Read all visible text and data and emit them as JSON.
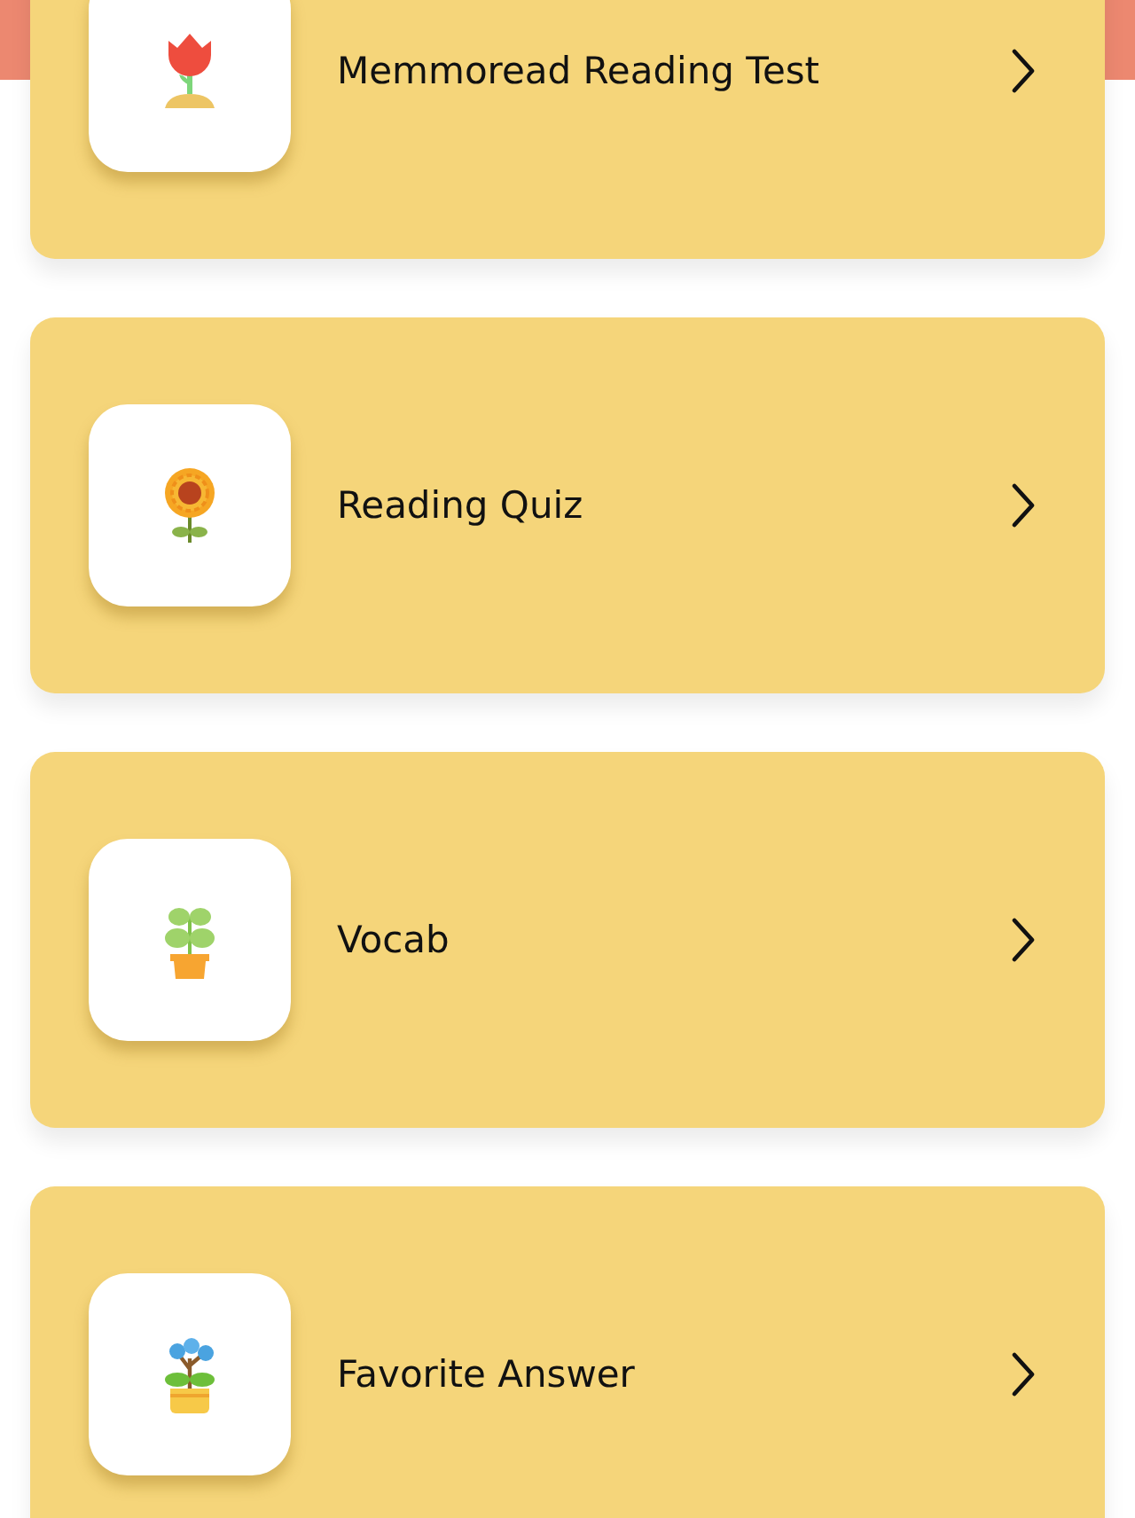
{
  "menu_items": [
    {
      "label": "Memmoread Reading Test",
      "kind": "tulip"
    },
    {
      "label": "Reading Quiz",
      "kind": "sunflower"
    },
    {
      "label": "Vocab",
      "kind": "sprout"
    },
    {
      "label": "Favorite Answer",
      "kind": "blossom"
    }
  ]
}
